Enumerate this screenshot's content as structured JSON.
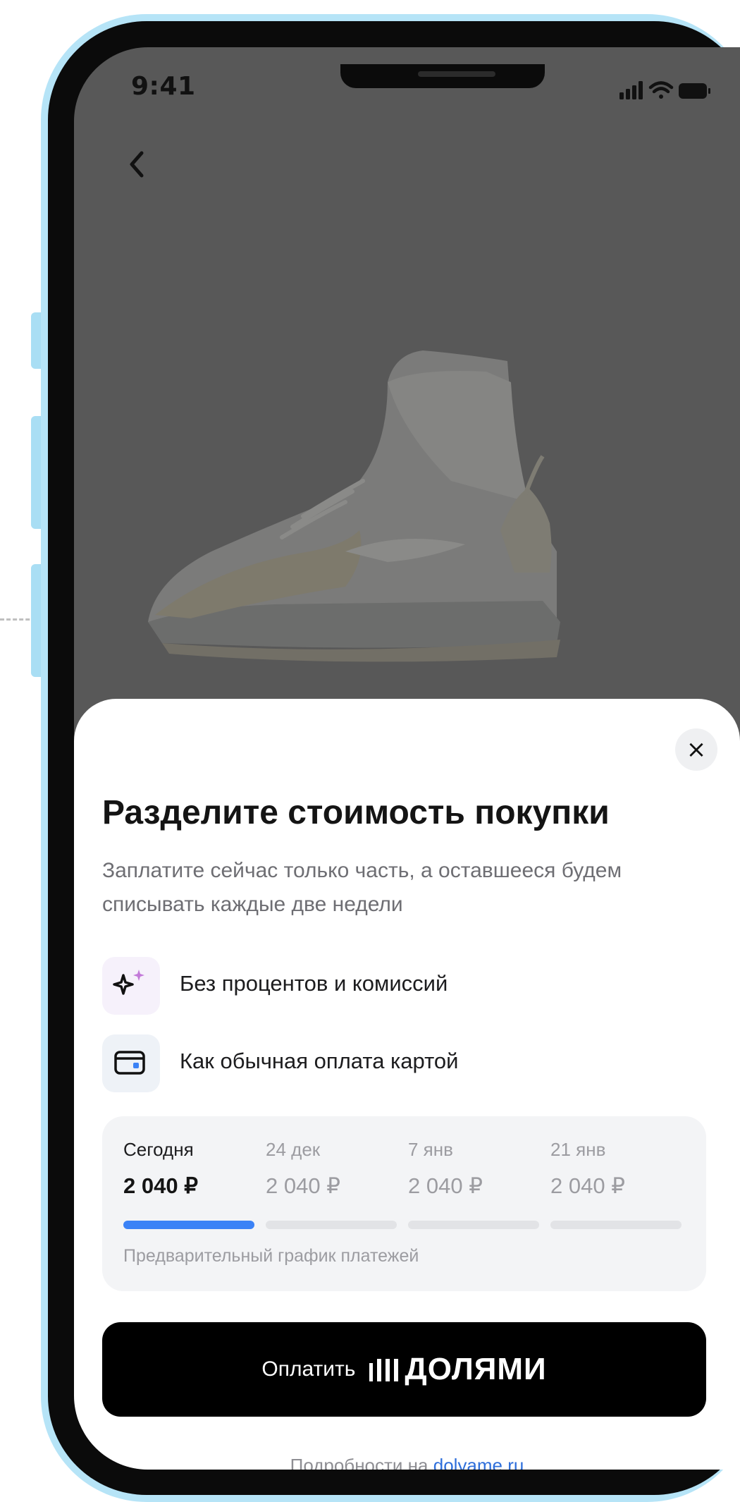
{
  "status_bar": {
    "time": "9:41"
  },
  "sheet": {
    "close_icon": "×",
    "title": "Разделите стоимость покупки",
    "subtitle": "Заплатите сейчас только часть, а оставшееся будем списывать каждые две недели",
    "features": [
      {
        "icon": "sparkle-icon",
        "label": "Без процентов и комиссий"
      },
      {
        "icon": "card-icon",
        "label": "Как обычная оплата картой"
      }
    ],
    "schedule": {
      "payments": [
        {
          "date": "Сегодня",
          "amount": "2 040 ₽",
          "active": true
        },
        {
          "date": "24 дек",
          "amount": "2 040 ₽",
          "active": false
        },
        {
          "date": "7 янв",
          "amount": "2 040 ₽",
          "active": false
        },
        {
          "date": "21 янв",
          "amount": "2 040 ₽",
          "active": false
        }
      ],
      "note": "Предварительный график платежей"
    },
    "pay_button": {
      "prefix": "Оплатить",
      "brand": "ДОЛЯМИ"
    },
    "details": {
      "text": "Подробности на",
      "link": "dolyame.ru"
    }
  },
  "colors": {
    "accent": "#3b82f6",
    "frame": "#b6e4f7",
    "overlay": "#585858",
    "button": "#000000"
  }
}
